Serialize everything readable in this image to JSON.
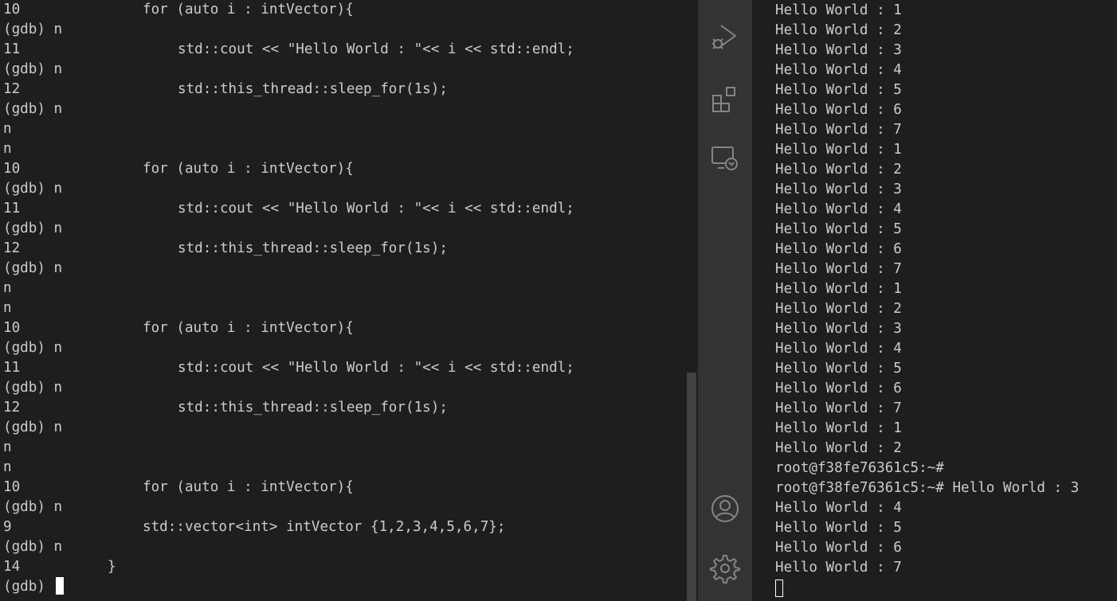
{
  "gdb_terminal": {
    "lines": [
      {
        "num": "10",
        "code": "for (auto i : intVector){",
        "indent": 1
      },
      {
        "text": "(gdb) n"
      },
      {
        "num": "11",
        "code": "std::cout << \"Hello World : \"<< i << std::endl;",
        "indent": 2
      },
      {
        "text": "(gdb) n"
      },
      {
        "num": "12",
        "code": "std::this_thread::sleep_for(1s);",
        "indent": 2
      },
      {
        "text": "(gdb) n"
      },
      {
        "text": "n"
      },
      {
        "text": "n"
      },
      {
        "num": "10",
        "code": "for (auto i : intVector){",
        "indent": 1
      },
      {
        "text": "(gdb) n"
      },
      {
        "num": "11",
        "code": "std::cout << \"Hello World : \"<< i << std::endl;",
        "indent": 2
      },
      {
        "text": "(gdb) n"
      },
      {
        "num": "12",
        "code": "std::this_thread::sleep_for(1s);",
        "indent": 2
      },
      {
        "text": "(gdb) n"
      },
      {
        "text": "n"
      },
      {
        "text": "n"
      },
      {
        "num": "10",
        "code": "for (auto i : intVector){",
        "indent": 1
      },
      {
        "text": "(gdb) n"
      },
      {
        "num": "11",
        "code": "std::cout << \"Hello World : \"<< i << std::endl;",
        "indent": 2
      },
      {
        "text": "(gdb) n"
      },
      {
        "num": "12",
        "code": "std::this_thread::sleep_for(1s);",
        "indent": 2
      },
      {
        "text": "(gdb) n"
      },
      {
        "text": "n"
      },
      {
        "text": "n"
      },
      {
        "num": "10",
        "code": "for (auto i : intVector){",
        "indent": 1
      },
      {
        "text": "(gdb) n"
      },
      {
        "num": "9",
        "code": "std::vector<int> intVector {1,2,3,4,5,6,7};",
        "indent": 1
      },
      {
        "text": "(gdb) n"
      },
      {
        "num": "14",
        "code": "}",
        "indent": 0
      },
      {
        "text": "(gdb) ",
        "cursor": true
      }
    ]
  },
  "activity_bar": {
    "icons": [
      "run-debug-icon",
      "extensions-icon",
      "remote-explorer-icon",
      "account-icon",
      "settings-gear-icon"
    ]
  },
  "output_terminal": {
    "lines": [
      "Hello World : 1",
      "Hello World : 2",
      "Hello World : 3",
      "Hello World : 4",
      "Hello World : 5",
      "Hello World : 6",
      "Hello World : 7",
      "Hello World : 1",
      "Hello World : 2",
      "Hello World : 3",
      "Hello World : 4",
      "Hello World : 5",
      "Hello World : 6",
      "Hello World : 7",
      "Hello World : 1",
      "Hello World : 2",
      "Hello World : 3",
      "Hello World : 4",
      "Hello World : 5",
      "Hello World : 6",
      "Hello World : 7",
      "Hello World : 1",
      "Hello World : 2",
      "root@f38fe76361c5:~#",
      "root@f38fe76361c5:~# Hello World : 3",
      "Hello World : 4",
      "Hello World : 5",
      "Hello World : 6",
      "Hello World : 7"
    ]
  }
}
